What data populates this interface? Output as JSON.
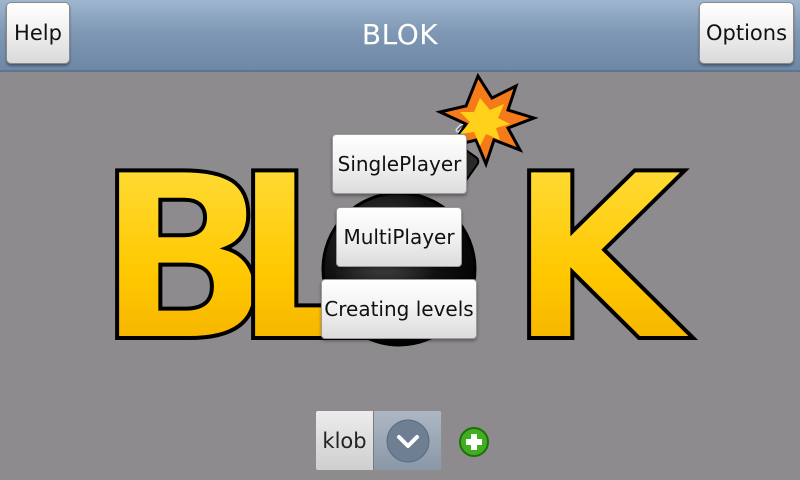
{
  "header": {
    "title": "BLOK",
    "help_label": "Help",
    "options_label": "Options"
  },
  "logo": {
    "letters": [
      "B",
      "L",
      "K"
    ],
    "letter_color": "#ffcc00",
    "bomb_color": "#000000",
    "spark_color": "#f47a1a"
  },
  "menu": {
    "single_player_label": "SinglePlayer",
    "multi_player_label": "MultiPlayer",
    "creating_levels_label": "Creating levels"
  },
  "profile": {
    "selected_value": "klob",
    "dropdown_icon": "chevron-down-icon",
    "add_icon": "plus-circle-icon",
    "add_color": "#3fae1f"
  }
}
